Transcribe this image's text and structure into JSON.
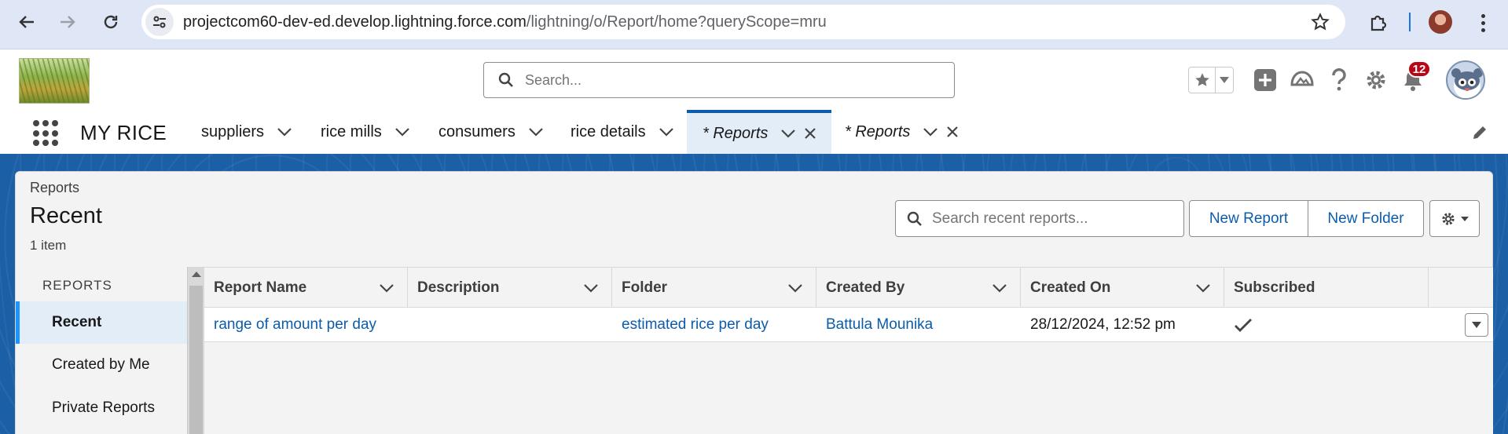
{
  "browser": {
    "url_host": "projectcom60-dev-ed.develop.lightning.force.com",
    "url_path": "/lightning/o/Report/home?queryScope=mru"
  },
  "header": {
    "search_placeholder": "Search...",
    "notification_count": "12"
  },
  "appnav": {
    "app_name": "MY RICE",
    "items": [
      {
        "label": "suppliers"
      },
      {
        "label": "rice mills"
      },
      {
        "label": "consumers"
      },
      {
        "label": "rice details"
      },
      {
        "label": "* Reports"
      },
      {
        "label": "* Reports"
      }
    ]
  },
  "page": {
    "kicker": "Reports",
    "title": "Recent",
    "count": "1 item",
    "search_placeholder": "Search recent reports...",
    "new_report_label": "New Report",
    "new_folder_label": "New Folder"
  },
  "sidebar": {
    "section": "REPORTS",
    "items": [
      {
        "label": "Recent"
      },
      {
        "label": "Created by Me"
      },
      {
        "label": "Private Reports"
      }
    ]
  },
  "table": {
    "columns": [
      "Report Name",
      "Description",
      "Folder",
      "Created By",
      "Created On",
      "Subscribed"
    ],
    "rows": [
      {
        "report_name": "range of amount per day",
        "description": "",
        "folder": "estimated rice per day",
        "created_by": "Battula Mounika",
        "created_on": "28/12/2024, 12:52 pm",
        "subscribed": true
      }
    ]
  }
}
